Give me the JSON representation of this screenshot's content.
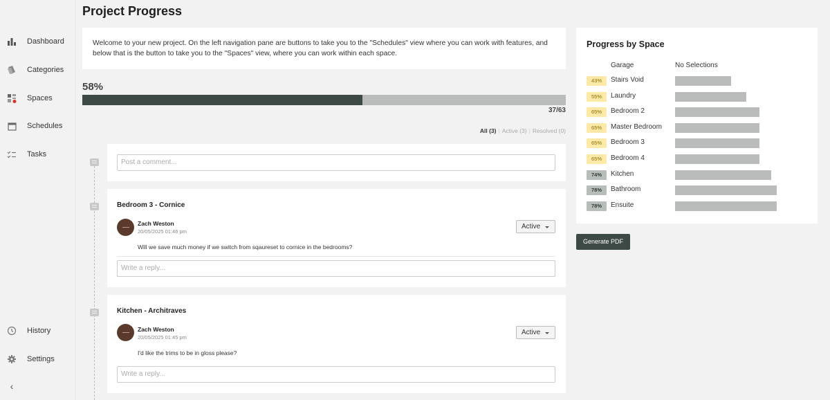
{
  "page": {
    "title": "Project Progress"
  },
  "sidebar": {
    "items": [
      {
        "label": "Dashboard",
        "icon": "bar-chart-icon"
      },
      {
        "label": "Categories",
        "icon": "tags-icon"
      },
      {
        "label": "Spaces",
        "icon": "grid-icon"
      },
      {
        "label": "Schedules",
        "icon": "calendar-icon"
      },
      {
        "label": "Tasks",
        "icon": "checklist-icon"
      },
      {
        "label": "History",
        "icon": "history-icon"
      },
      {
        "label": "Settings",
        "icon": "gear-icon"
      }
    ],
    "collapse_icon": "chevron-left-icon",
    "alert_color": "#d9342b"
  },
  "welcome": {
    "text": "Welcome to your new project. On the left navigation pane are buttons to take you to the \"Schedules\" view where you can work with features, and below that is the button to take you to the \"Spaces\" view, where you can work within each space."
  },
  "progress": {
    "percent_label": "58%",
    "fraction": 0.58,
    "count_label": "37/63",
    "fill_color": "#3d4945",
    "track_color": "#b9bcba"
  },
  "filters": {
    "all": "All (3)",
    "active": "Active (3)",
    "resolved": "Resolved (0)"
  },
  "comment_box": {
    "placeholder": "Post a comment..."
  },
  "threads": [
    {
      "title": "Bedroom 3 - Cornice",
      "author": "Zach Weston",
      "date": "20/05/2025 01:46 pm",
      "message": "Will we save much money if we switch from sqaureset to cornice in the bedrooms?",
      "status": "Active",
      "reply_placeholder": "Write a reply..."
    },
    {
      "title": "Kitchen - Architraves",
      "author": "Zach Weston",
      "date": "20/05/2025 01:45 pm",
      "message": "I'd like the trims to be in gloss please?",
      "status": "Active",
      "reply_placeholder": "Write a reply..."
    }
  ],
  "space_panel": {
    "title": "Progress by Space",
    "col_space": "Garage",
    "col_status": "No Selections",
    "spaces": [
      {
        "percent": "43%",
        "name": "Stairs Void",
        "value": 0.43,
        "tone": "yellow"
      },
      {
        "percent": "55%",
        "name": "Laundry",
        "value": 0.55,
        "tone": "yellow"
      },
      {
        "percent": "65%",
        "name": "Bedroom 2",
        "value": 0.65,
        "tone": "yellow"
      },
      {
        "percent": "65%",
        "name": "Master Bedroom",
        "value": 0.65,
        "tone": "yellow"
      },
      {
        "percent": "65%",
        "name": "Bedroom 3",
        "value": 0.65,
        "tone": "yellow"
      },
      {
        "percent": "65%",
        "name": "Bedroom 4",
        "value": 0.65,
        "tone": "yellow"
      },
      {
        "percent": "74%",
        "name": "Kitchen",
        "value": 0.74,
        "tone": "gray"
      },
      {
        "percent": "78%",
        "name": "Bathroom",
        "value": 0.78,
        "tone": "gray"
      },
      {
        "percent": "78%",
        "name": "Ensuite",
        "value": 0.78,
        "tone": "gray"
      }
    ]
  },
  "actions": {
    "generate_pdf": "Generate PDF"
  }
}
